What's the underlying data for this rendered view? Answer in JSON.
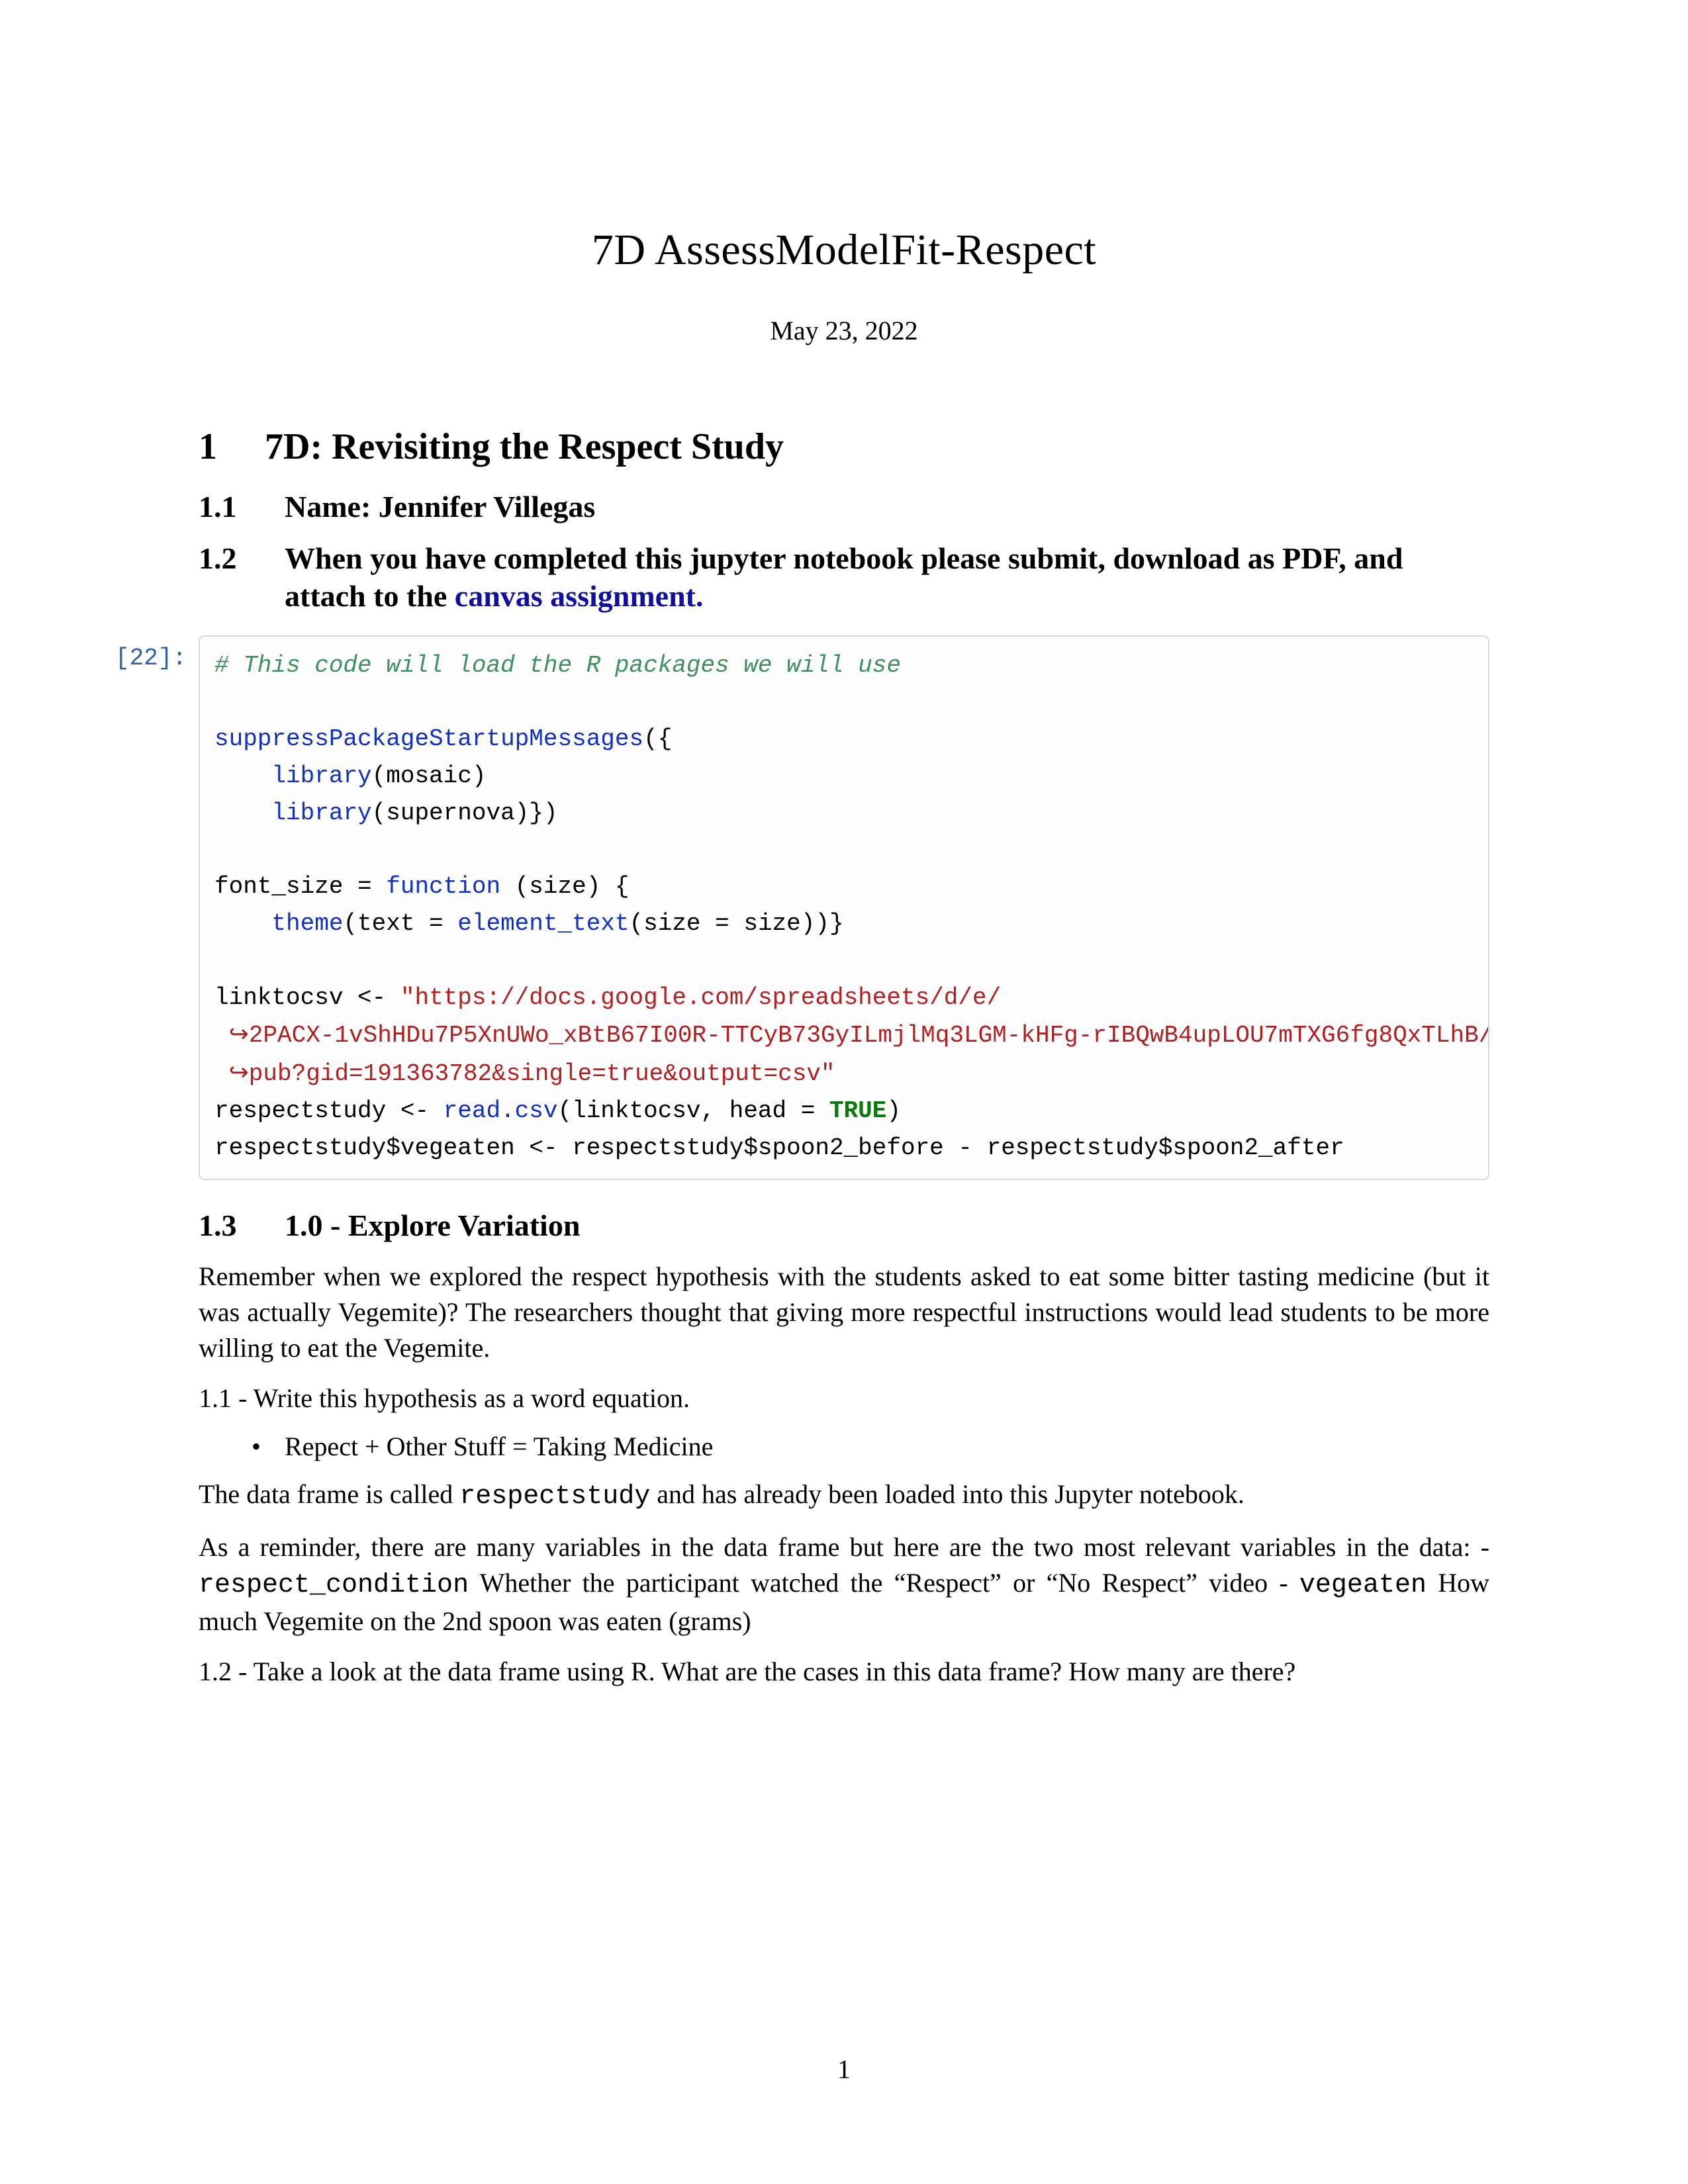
{
  "title": "7D AssessModelFit-Respect",
  "date": "May 23, 2022",
  "h1": {
    "num": "1",
    "text": "7D: Revisiting the Respect Study"
  },
  "h2a": {
    "num": "1.1",
    "text": "Name: Jennifer Villegas"
  },
  "h2b": {
    "num": "1.2",
    "part1": "When you have completed this jupyter notebook please submit, download as PDF, and attach to the ",
    "link": "canvas assignment."
  },
  "prompt": "[22]:",
  "code": {
    "l01": "# This code will load the R packages we will use",
    "l03a": "suppressPackageStartupMessages",
    "l03b": "({",
    "l04a": "library",
    "l04b": "(mosaic)",
    "l05a": "library",
    "l05b": "(supernova)})",
    "l07a": "font_size = ",
    "l07b": "function",
    "l07c": " (size) {",
    "l08a": "theme",
    "l08b": "(text = ",
    "l08c": "element_text",
    "l08d": "(size = size))}",
    "l10a": "linktocsv <- ",
    "l10b": "\"https://docs.google.com/spreadsheets/d/e/",
    "l11": "2PACX-1vShHDu7P5XnUWo_xBtB67I00R-TTCyB73GyILmjlMq3LGM-kHFg-rIBQwB4upLOU7mTXG6fg8QxTLhB/",
    "l12": "pub?gid=191363782&single=true&output=csv\"",
    "l13a": "respectstudy <- ",
    "l13b": "read.csv",
    "l13c": "(linktocsv, head = ",
    "l13d": "TRUE",
    "l13e": ")",
    "l14": "respectstudy$vegeaten <- respectstudy$spoon2_before - respectstudy$spoon2_after",
    "hook": "↪"
  },
  "h2c": {
    "num": "1.3",
    "text": "1.0 - Explore Variation"
  },
  "para1": "Remember when we explored the respect hypothesis with the students asked to eat some bitter tasting medicine (but it was actually Vegemite)? The researchers thought that giving more respectful instructions would lead students to be more willing to eat the Vegemite.",
  "para2": "1.1 - Write this hypothesis as a word equation.",
  "bullet": "Repect + Other Stuff = Taking Medicine",
  "para3a": "The data frame is called ",
  "para3b": "respectstudy",
  "para3c": " and has already been loaded into this Jupyter notebook.",
  "para4a": "As a reminder, there are many variables in the data frame but here are the two most relevant variables in the data: - ",
  "para4b": "respect_condition",
  "para4c": " Whether the participant watched the “Respect” or “No Respect” video - ",
  "para4d": "vegeaten",
  "para4e": " How much Vegemite on the 2nd spoon was eaten (grams)",
  "para5": "1.2 - Take a look at the data frame using R. What are the cases in this data frame? How many are there?",
  "pageNum": "1"
}
